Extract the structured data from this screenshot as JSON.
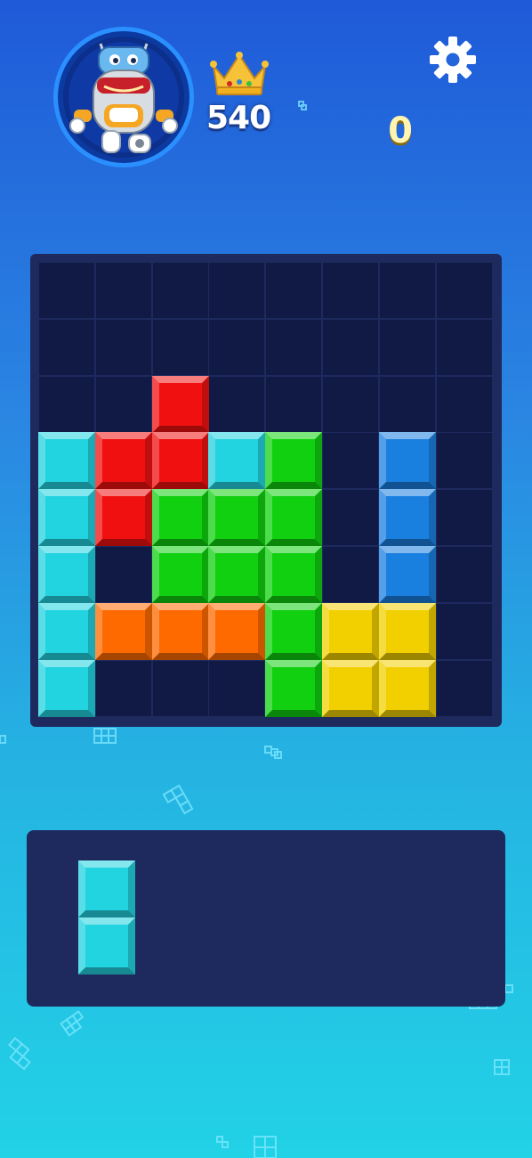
{
  "header": {
    "best_score": "540",
    "current_score": "0"
  },
  "icons": {
    "avatar": "robot-avatar",
    "best_score": "crown-icon",
    "settings": "gear-icon"
  },
  "colors": {
    "empty_cell": "#101a44",
    "board_frame": "#1e2a5e",
    "cyan": "#22d3e0",
    "red": "#f01010",
    "green": "#10d010",
    "blue": "#1a80e0",
    "orange": "#ff6a00",
    "yellow": "#f2d000"
  },
  "board": {
    "columns": 8,
    "rows": 8,
    "grid": [
      [
        null,
        null,
        null,
        null,
        null,
        null,
        null,
        null
      ],
      [
        null,
        null,
        null,
        null,
        null,
        null,
        null,
        null
      ],
      [
        null,
        null,
        "red",
        null,
        null,
        null,
        null,
        null
      ],
      [
        "cyan",
        "red",
        "red",
        "cyan",
        "green",
        null,
        "blue",
        null
      ],
      [
        "cyan",
        "red",
        "green",
        "green",
        "green",
        null,
        "blue",
        null
      ],
      [
        "cyan",
        null,
        "green",
        "green",
        "green",
        null,
        "blue",
        null
      ],
      [
        "cyan",
        "orange",
        "orange",
        "orange",
        "green",
        "yellow",
        "yellow",
        null
      ],
      [
        "cyan",
        null,
        null,
        null,
        "green",
        "yellow",
        "yellow",
        null
      ]
    ]
  },
  "tray": {
    "pieces": [
      {
        "color": "cyan",
        "cells": [
          [
            0,
            0
          ],
          [
            1,
            0
          ]
        ]
      }
    ]
  }
}
